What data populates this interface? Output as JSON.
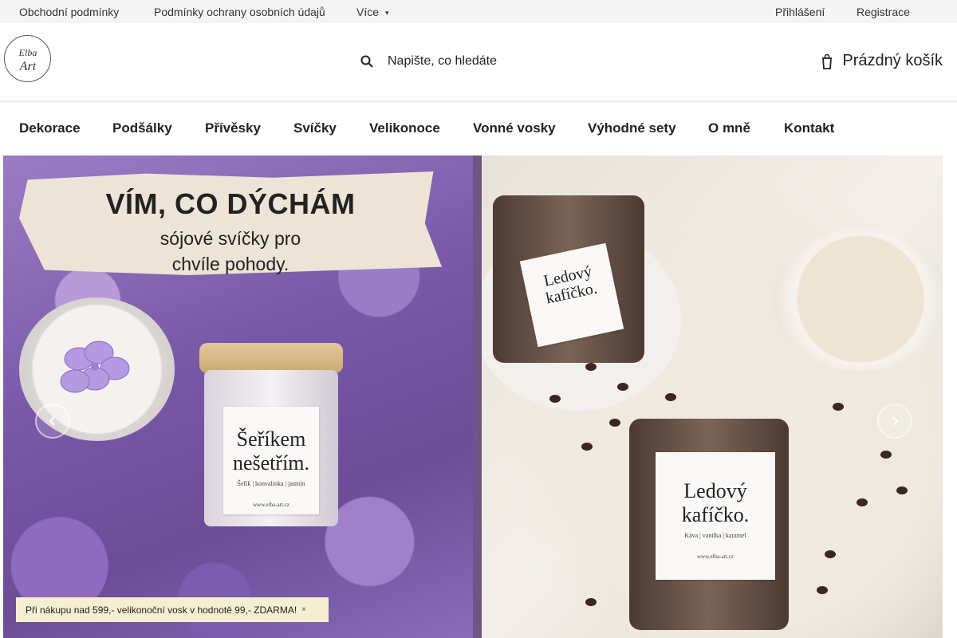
{
  "topbar": {
    "links": [
      "Obchodní podmínky",
      "Podmínky ochrany osobních údajů",
      "Více"
    ],
    "login": "Přihlášení",
    "register": "Registrace"
  },
  "header": {
    "logo": {
      "text_top": "Elba",
      "text_bottom": "Art"
    },
    "search_placeholder": "Napište, co hledáte",
    "cart_label": "Prázdný košík"
  },
  "nav": {
    "items": [
      "Dekorace",
      "Podšálky",
      "Přívěsky",
      "Svíčky",
      "Velikonoce",
      "Vonné vosky",
      "Výhodné sety",
      "O mně",
      "Kontakt"
    ]
  },
  "hero": {
    "left": {
      "headline": "VÍM, CO DÝCHÁM",
      "subline": "sójové svíčky pro\nchvíle pohody.",
      "label_title": "Šeříkem\nnešetřím.",
      "label_notes": "Šeřík | konvalinka | jasmín",
      "label_url": "www.elba-art.cz"
    },
    "right": {
      "label_title": "Ledový\nkafíčko.",
      "label_notes": "Káva | vanilka | karamel",
      "label_url": "www.elba-art.cz"
    },
    "icons": {
      "prev": "chevron-left-icon",
      "next": "chevron-right-icon"
    }
  },
  "promo": {
    "text": "Při nákupu nad 599,- velikonoční vosk v hodnotě 99,- ZDARMA!",
    "close": "×"
  },
  "colors": {
    "topbar_bg": "#f4f4f4",
    "promo_bg": "#f5efd2",
    "lilac": "#8f6bbf",
    "coffee": "#3b2620"
  }
}
